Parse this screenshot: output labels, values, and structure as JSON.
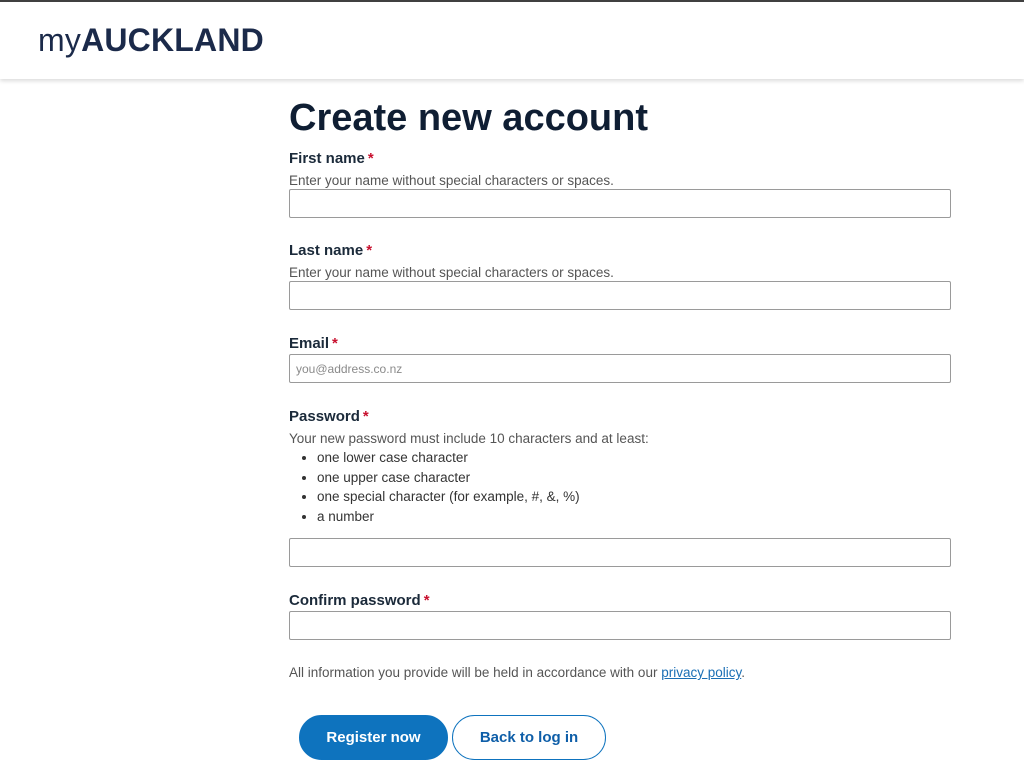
{
  "header": {
    "logo_prefix": "my",
    "logo_name": "AUCKLAND"
  },
  "page": {
    "title": "Create new account"
  },
  "form": {
    "required_marker": "*",
    "first_name": {
      "label": "First name",
      "hint": "Enter your name without special characters or spaces.",
      "value": ""
    },
    "last_name": {
      "label": "Last name",
      "hint": "Enter your name without special characters or spaces.",
      "value": ""
    },
    "email": {
      "label": "Email",
      "placeholder": "you@address.co.nz",
      "value": ""
    },
    "password": {
      "label": "Password",
      "hint": "Your new password must include 10 characters and at least:",
      "rules": [
        "one lower case character",
        "one upper case character",
        "one special character (for example, #, &, %)",
        "a number"
      ],
      "value": ""
    },
    "confirm_password": {
      "label": "Confirm password",
      "value": ""
    },
    "privacy_text": "All information you provide will be held in accordance with our",
    "privacy_link": "privacy policy",
    "privacy_end": "."
  },
  "actions": {
    "register_label": "Register now",
    "back_label": "Back to log in"
  },
  "colors": {
    "primary": "#0e73be",
    "required": "#c8102e",
    "heading": "#0f1e33",
    "link": "#1a6fb5"
  }
}
